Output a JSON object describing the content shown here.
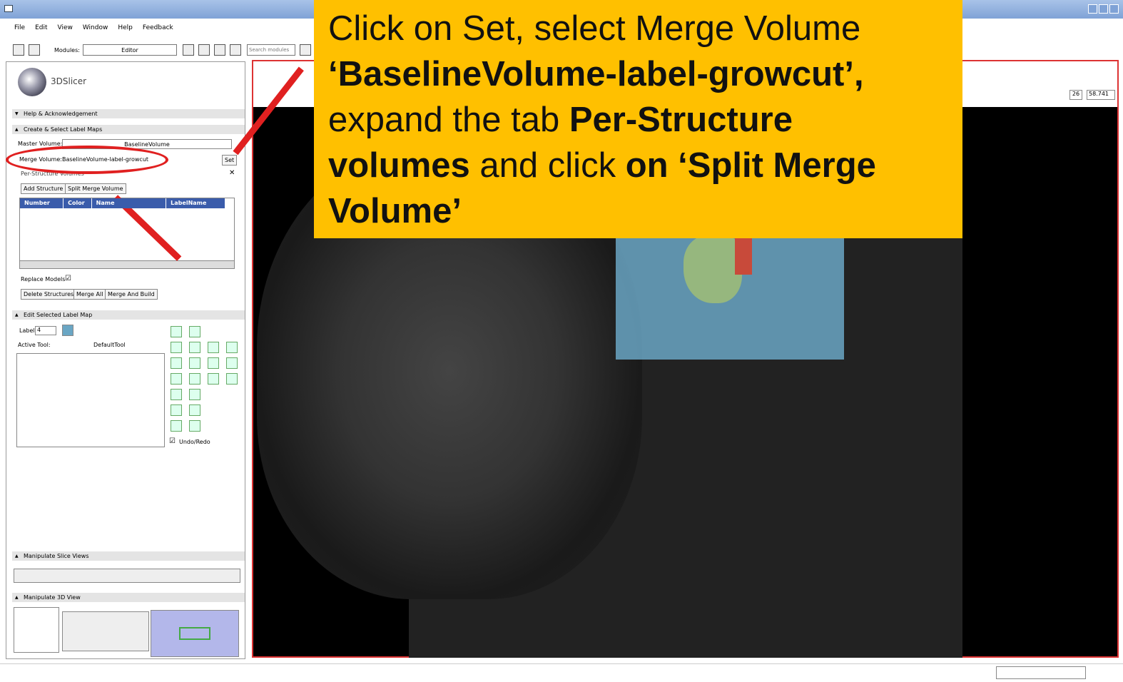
{
  "menu": [
    "File",
    "Edit",
    "View",
    "Window",
    "Help",
    "Feedback"
  ],
  "toolbar": {
    "modules_label": "Modules:",
    "module_value": "Editor",
    "search_placeholder": "Search modules"
  },
  "app": {
    "logo_text": "3DSlicer"
  },
  "sections": {
    "help": "Help & Acknowledgement",
    "create": "Create & Select Label Maps",
    "master_label": "Master Volume:",
    "master_value": "BaselineVolume",
    "merge_label": "Merge Volume:",
    "merge_value": "BaselineVolume-label-growcut",
    "set_button": "Set",
    "per_structure": "Per-Structure Volumes",
    "add_structure": "Add Structure",
    "split_merge": "Split Merge Volume",
    "columns": [
      "Number",
      "Color",
      "Name",
      "LabelName"
    ],
    "replace_models": "Replace Models",
    "delete_structures": "Delete Structures",
    "merge_all": "Merge All",
    "merge_build": "Merge And Build",
    "edit_label_map": "Edit Selected Label Map",
    "label_text": "Label",
    "label_value": "4",
    "active_tool_label": "Active Tool:",
    "active_tool_value": "DefaultTool",
    "undo_redo": "Undo/Redo",
    "slice_views": "Manipulate Slice Views",
    "view_3d": "Manipulate 3D View"
  },
  "viewer": {
    "slice_num": "26",
    "slice_pos": "58.741"
  },
  "callout": {
    "line1": "Click on Set, select Merge Volume",
    "line2": "‘BaselineVolume-label-growcut’,",
    "line3a": "expand the tab ",
    "line3b": "Per-Structure",
    "line4a": "volumes",
    "line4b": " and click ",
    "line4c": "on ‘Split Merge",
    "line5": "Volume’"
  },
  "colors": {
    "callout_bg": "#ffc000",
    "annotation_red": "#e02020",
    "table_header": "#3a5cab"
  }
}
